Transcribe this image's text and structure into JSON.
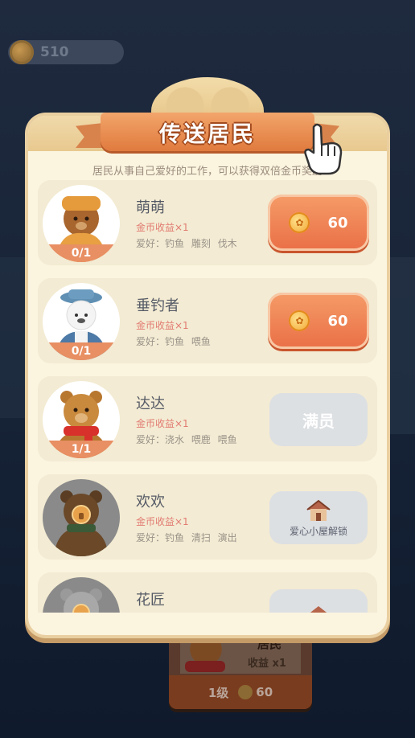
{
  "background": {
    "coin_value": "510",
    "card_title": "居民",
    "card_income": "收益 x1",
    "card_level": "1级",
    "card_price": "60"
  },
  "dialog": {
    "title": "传送居民",
    "subtitle": "居民从事自己爱好的工作，可以获得双倍金币奖励"
  },
  "residents": [
    {
      "name": "萌萌",
      "count": "0/1",
      "income": "金币收益×1",
      "hobby": "爱好：钓鱼 雕刻 伐木",
      "action": "price",
      "price": "60"
    },
    {
      "name": "垂钓者",
      "count": "0/1",
      "income": "金币收益×1",
      "hobby": "爱好：钓鱼 喂鱼",
      "action": "price",
      "price": "60"
    },
    {
      "name": "达达",
      "count": "1/1",
      "income": "金币收益×1",
      "hobby": "爱好：浇水 喂鹿 喂鱼",
      "action": "full",
      "full_label": "满员"
    },
    {
      "name": "欢欢",
      "income": "金币收益×1",
      "hobby": "爱好：钓鱼 清扫 演出",
      "action": "unlock",
      "unlock_label": "爱心小屋解锁"
    },
    {
      "name": "花匠",
      "action": "unlock"
    }
  ],
  "colors": {
    "accent": "#ea6f47",
    "panel": "#fbf4df",
    "card": "#f3ebd3",
    "income_text": "#e27b72"
  },
  "icons": [
    "coin-icon",
    "paw-coin-icon",
    "house-icon",
    "lock-icon",
    "hand-pointer-icon"
  ]
}
